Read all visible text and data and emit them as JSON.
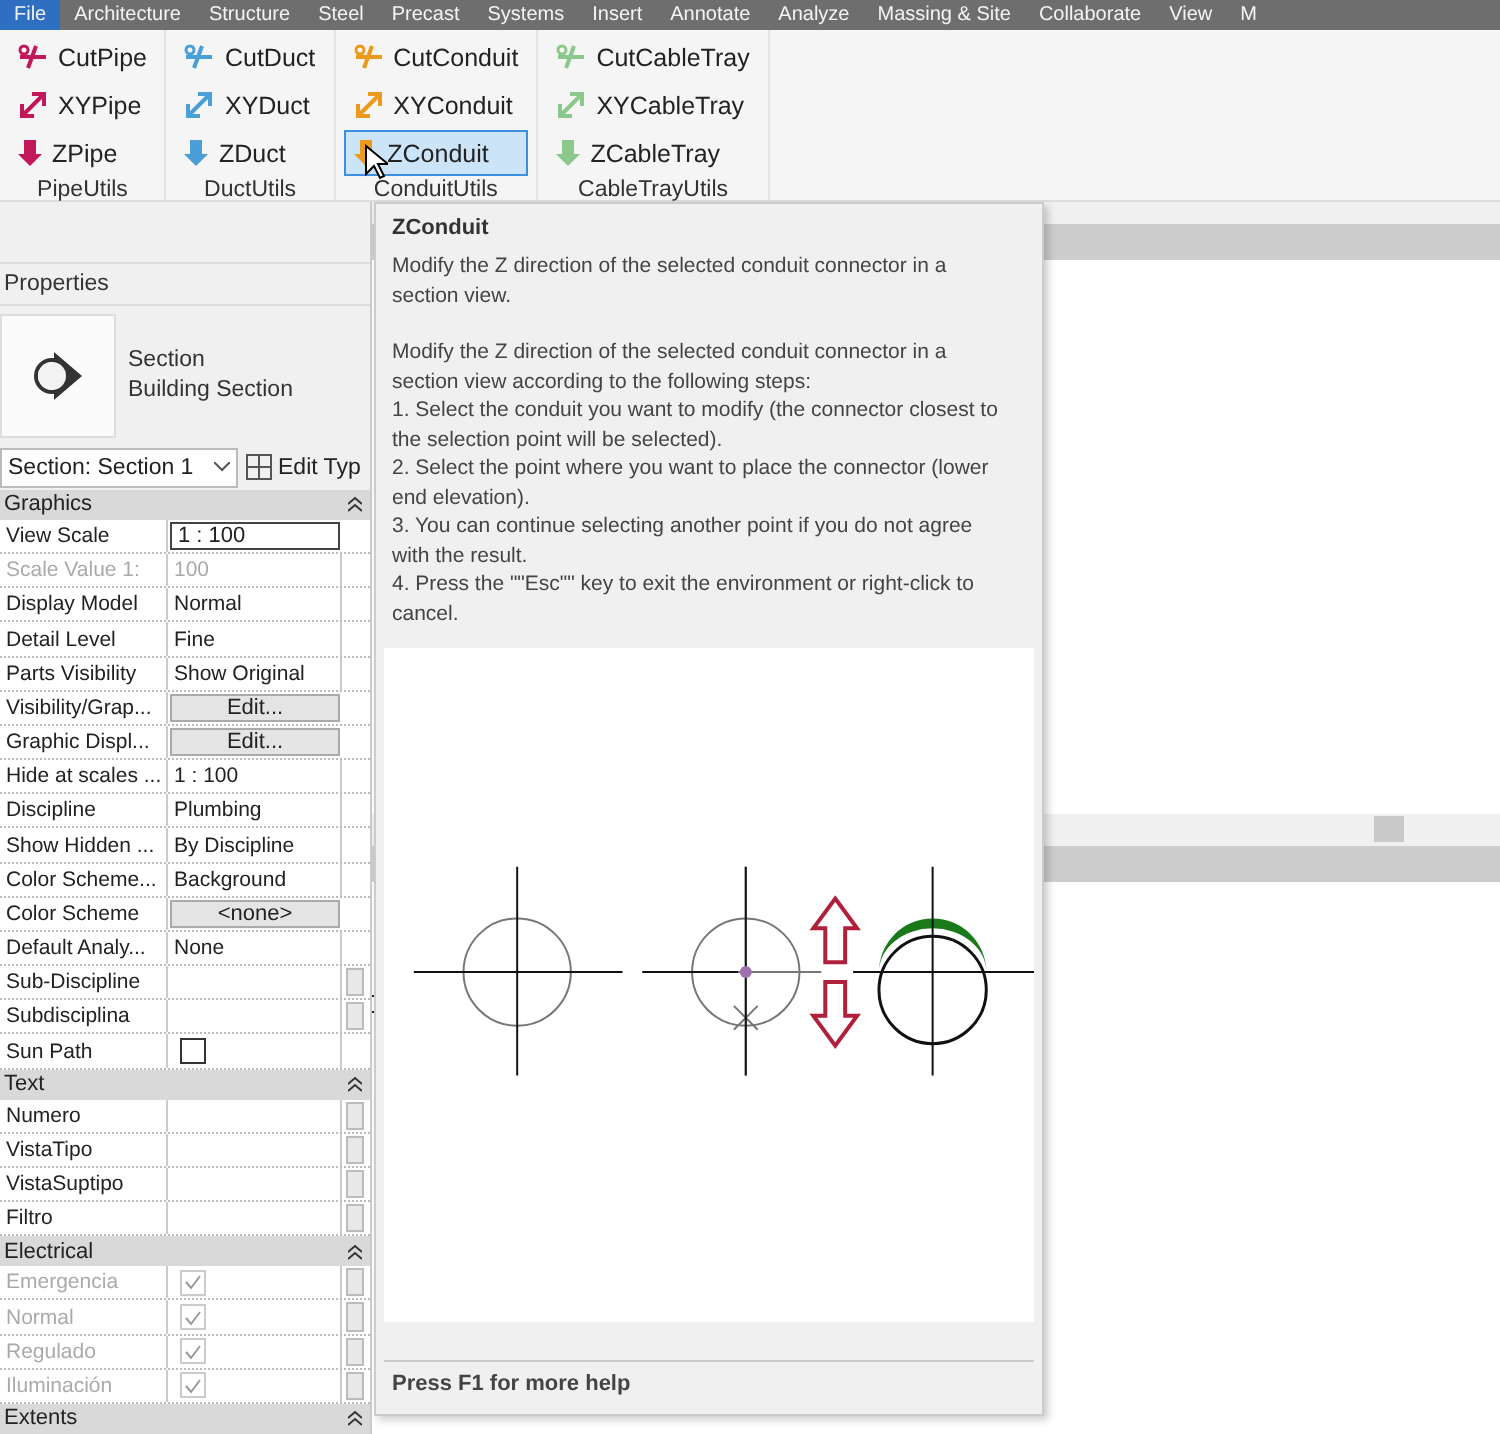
{
  "menu_tabs": [
    {
      "label": "File",
      "selected": true
    },
    {
      "label": "Architecture",
      "selected": false
    },
    {
      "label": "Structure",
      "selected": false
    },
    {
      "label": "Steel",
      "selected": false
    },
    {
      "label": "Precast",
      "selected": false
    },
    {
      "label": "Systems",
      "selected": false
    },
    {
      "label": "Insert",
      "selected": false
    },
    {
      "label": "Annotate",
      "selected": false
    },
    {
      "label": "Analyze",
      "selected": false
    },
    {
      "label": "Massing & Site",
      "selected": false
    },
    {
      "label": "Collaborate",
      "selected": false
    },
    {
      "label": "View",
      "selected": false
    },
    {
      "label": "M",
      "selected": false
    }
  ],
  "ribbon_panels": [
    {
      "title": "PipeUtils",
      "color": "#c2185b",
      "tools": [
        {
          "label": "CutPipe",
          "kind": "cut",
          "selected": false
        },
        {
          "label": "XYPipe",
          "kind": "xy",
          "selected": false
        },
        {
          "label": "ZPipe",
          "kind": "z",
          "selected": false
        }
      ]
    },
    {
      "title": "DuctUtils",
      "color": "#4a9fd8",
      "tools": [
        {
          "label": "CutDuct",
          "kind": "cut",
          "selected": false
        },
        {
          "label": "XYDuct",
          "kind": "xy",
          "selected": false
        },
        {
          "label": "ZDuct",
          "kind": "z",
          "selected": false
        }
      ]
    },
    {
      "title": "ConduitUtils",
      "color": "#eb9a1c",
      "tools": [
        {
          "label": "CutConduit",
          "kind": "cut",
          "selected": false
        },
        {
          "label": "XYConduit",
          "kind": "xy",
          "selected": false
        },
        {
          "label": "ZConduit",
          "kind": "z",
          "selected": true
        }
      ]
    },
    {
      "title": "CableTrayUtils",
      "color": "#8cc78c",
      "tools": [
        {
          "label": "CutCableTray",
          "kind": "cut",
          "selected": false
        },
        {
          "label": "XYCableTray",
          "kind": "xy",
          "selected": false
        },
        {
          "label": "ZCableTray",
          "kind": "z",
          "selected": false
        }
      ]
    }
  ],
  "properties": {
    "title": "Properties",
    "type_name": "Section",
    "type_family": "Building Section",
    "selector": "Section: Section 1",
    "edit_type": "Edit Typ",
    "groups": [
      {
        "name": "Graphics",
        "rows": [
          {
            "label": "View Scale",
            "value": "1 : 100",
            "kind": "field",
            "disabled": false,
            "linked": false
          },
          {
            "label": "Scale Value    1:",
            "value": "100",
            "kind": "text",
            "disabled": true,
            "linked": false
          },
          {
            "label": "Display Model",
            "value": "Normal",
            "kind": "text",
            "disabled": false,
            "linked": false
          },
          {
            "label": "Detail Level",
            "value": "Fine",
            "kind": "text",
            "disabled": false,
            "linked": false
          },
          {
            "label": "Parts Visibility",
            "value": "Show Original",
            "kind": "text",
            "disabled": false,
            "linked": false
          },
          {
            "label": "Visibility/Grap...",
            "value": "Edit...",
            "kind": "button",
            "disabled": false,
            "linked": false
          },
          {
            "label": "Graphic Displ...",
            "value": "Edit...",
            "kind": "button",
            "disabled": false,
            "linked": false
          },
          {
            "label": "Hide at scales ...",
            "value": "1 : 100",
            "kind": "text",
            "disabled": false,
            "linked": false
          },
          {
            "label": "Discipline",
            "value": "Plumbing",
            "kind": "text",
            "disabled": false,
            "linked": false
          },
          {
            "label": "Show Hidden ...",
            "value": "By Discipline",
            "kind": "text",
            "disabled": false,
            "linked": false
          },
          {
            "label": "Color Scheme...",
            "value": "Background",
            "kind": "text",
            "disabled": false,
            "linked": false
          },
          {
            "label": "Color Scheme",
            "value": "<none>",
            "kind": "button",
            "disabled": false,
            "linked": false
          },
          {
            "label": "Default Analy...",
            "value": "None",
            "kind": "text",
            "disabled": false,
            "linked": false
          },
          {
            "label": "Sub-Discipline",
            "kind": "text",
            "disabled": false,
            "linked": true
          },
          {
            "label": "Subdisciplina",
            "kind": "text",
            "disabled": false,
            "linked": true
          },
          {
            "label": "Sun Path",
            "kind": "checkbox",
            "checked": false,
            "disabled": false,
            "linked": false
          }
        ]
      },
      {
        "name": "Text",
        "rows": [
          {
            "label": "Numero",
            "kind": "text",
            "disabled": false,
            "linked": true
          },
          {
            "label": "VistaTipo",
            "kind": "text",
            "disabled": false,
            "linked": true
          },
          {
            "label": "VistaSuptipo",
            "kind": "text",
            "disabled": false,
            "linked": true
          },
          {
            "label": "Filtro",
            "kind": "text",
            "disabled": false,
            "linked": true
          }
        ]
      },
      {
        "name": "Electrical",
        "rows": [
          {
            "label": "Emergencia",
            "kind": "checkbox",
            "checked": true,
            "disabled": true,
            "linked": true
          },
          {
            "label": "Normal",
            "kind": "checkbox",
            "checked": true,
            "disabled": true,
            "linked": true
          },
          {
            "label": "Regulado",
            "kind": "checkbox",
            "checked": true,
            "disabled": true,
            "linked": true
          },
          {
            "label": "Iluminación",
            "kind": "checkbox",
            "checked": true,
            "disabled": true,
            "linked": true
          }
        ]
      },
      {
        "name": "Extents"
      }
    ]
  },
  "tooltip": {
    "title": "ZConduit",
    "summary": "Modify the Z direction of the selected conduit connector in a section view.",
    "paragraphs": [
      "Modify the Z direction of the selected conduit connector in a section view according to the following steps:",
      "1. Select the conduit you want to modify (the connector closest to the selection point will be selected).",
      "2. Select the point where you want to place the connector (lower end elevation).",
      "3. You can continue selecting another point if you do not agree with the result.",
      "4. Press the \"\"Esc\"\" key to exit the environment or right-click to cancel."
    ],
    "footer": "Press F1 for more help"
  }
}
